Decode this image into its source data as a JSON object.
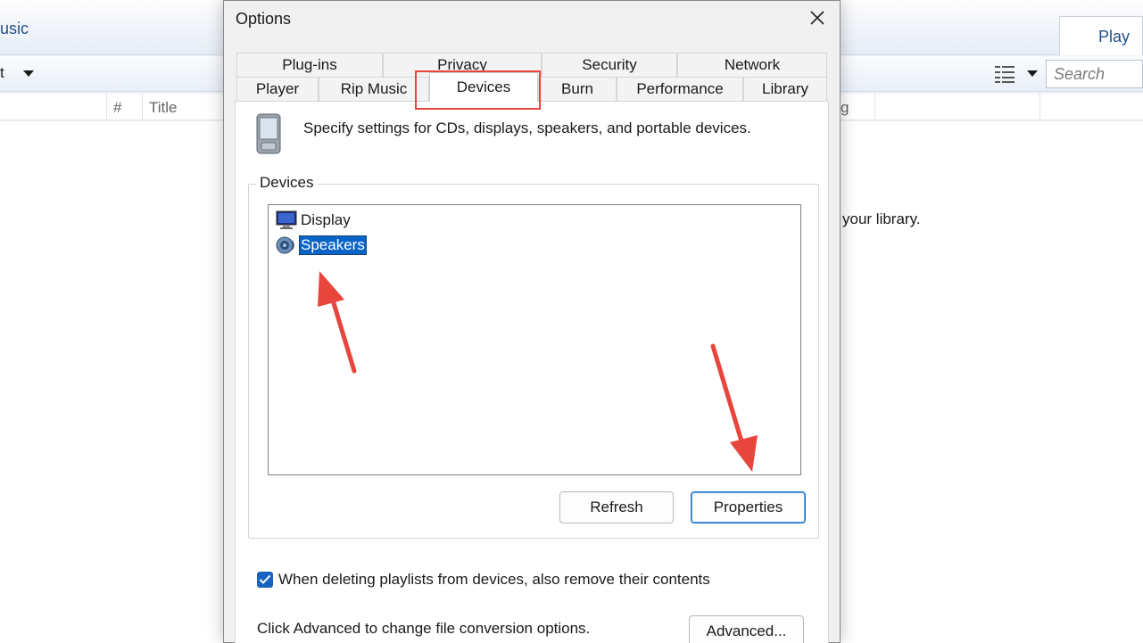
{
  "background": {
    "tab_left": "usic",
    "tab_play": "Play",
    "toolbar_left": "t",
    "search_placeholder": "Search",
    "columns": [
      "#",
      "Title",
      "g"
    ],
    "library_text": "your library."
  },
  "dialog": {
    "title": "Options",
    "close_icon": "close-icon",
    "tabs_row1": [
      "Plug-ins",
      "Privacy",
      "Security",
      "Network"
    ],
    "tabs_row2": [
      "Player",
      "Rip Music",
      "Devices",
      "Burn",
      "Performance",
      "Library"
    ],
    "active_tab": "Devices",
    "intro": "Specify settings for CDs, displays, speakers, and portable devices.",
    "devices_group_label": "Devices",
    "devices": [
      {
        "label": "Display",
        "icon": "monitor-icon",
        "selected": false
      },
      {
        "label": "Speakers",
        "icon": "speaker-icon",
        "selected": true
      }
    ],
    "buttons": {
      "refresh": "Refresh",
      "properties": "Properties",
      "advanced": "Advanced..."
    },
    "checkbox": {
      "checked": true,
      "label": "When deleting playlists from devices, also remove their contents"
    },
    "advanced_text": "Click Advanced to change file conversion options."
  },
  "colors": {
    "annotation": "#e8453c",
    "selection": "#0a64c8",
    "checkbox": "#1764c0"
  }
}
